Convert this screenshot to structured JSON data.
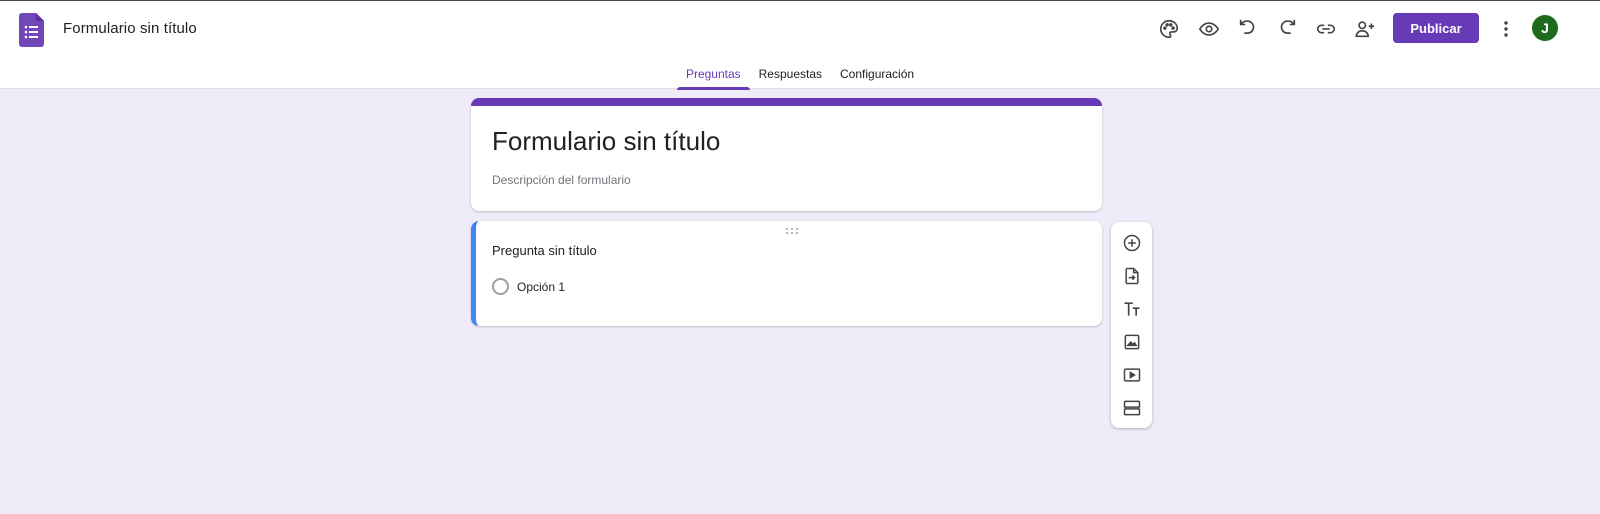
{
  "header": {
    "doc_title": "Formulario sin título",
    "publish_label": "Publicar",
    "avatar_initial": "J",
    "toolbar_icons": [
      "palette-icon",
      "preview-eye-icon",
      "undo-icon",
      "redo-icon",
      "link-icon",
      "add-collaborator-icon"
    ]
  },
  "tabs": [
    {
      "label": "Preguntas",
      "active": true
    },
    {
      "label": "Respuestas",
      "active": false
    },
    {
      "label": "Configuración",
      "active": false
    }
  ],
  "form": {
    "title": "Formulario sin título",
    "description_placeholder": "Descripción del formulario"
  },
  "question": {
    "title": "Pregunta sin título",
    "options": [
      "Opción 1"
    ]
  },
  "side_toolbar": [
    "add-question-icon",
    "import-questions-icon",
    "add-title-text-icon",
    "add-image-icon",
    "add-video-icon",
    "add-section-icon"
  ],
  "colors": {
    "accent": "#673ab7",
    "background": "#f0ebf8",
    "question_highlight": "#4285f4",
    "avatar": "#1e6b1e"
  }
}
